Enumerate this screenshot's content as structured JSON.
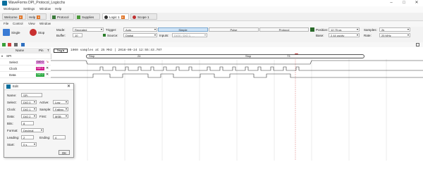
{
  "window": {
    "title": "WaveForms  DPI_Protocol_Logicchs",
    "minimize": "–",
    "maximize": "□",
    "close": "✕"
  },
  "menubar": {
    "items": [
      "Workspace",
      "Settings",
      "Window",
      "Help"
    ]
  },
  "tabs": [
    {
      "label": "Welcome"
    },
    {
      "label": "Help"
    },
    {
      "label": "Protocol"
    },
    {
      "label": "Supplies"
    },
    {
      "label": "Logic 1"
    },
    {
      "label": "Scope 1"
    }
  ],
  "submenu": {
    "items": [
      "File",
      "Control",
      "View",
      "Window"
    ]
  },
  "control": {
    "single_label": "Single",
    "stop_label": "Stop",
    "mode_label": "Mode:",
    "mode_value": "Repeated",
    "buffer_label": "Buffer:",
    "buffer_value": "10",
    "trigger_label": "Trigger:",
    "trigger_value": "Auto",
    "source_label": "Source:",
    "source_value": "Digital",
    "inputs_label": "Inputs:",
    "inputs_value": "DIO0 / DIO 1, ...",
    "trigger_tabs": [
      "Simple",
      "Pulse",
      "Protocol"
    ],
    "position_label": "Position:",
    "position_value": "12.75 us",
    "base_label": "Base:",
    "base_value": "2.44 us/div",
    "samples_label": "Samples:",
    "samples_value": "2k",
    "rate_label": "Rate:",
    "rate_value": "25 MHz"
  },
  "channels_header": {
    "name": "Name",
    "pin": "Pin",
    "t_label": "T"
  },
  "ruler": {
    "banner": "1000 samples at 25 MHz | 2018-09-24 12:55:43.707",
    "trigd": "Trig'd"
  },
  "channels": [
    {
      "name": "SPI",
      "pin": "",
      "color": "#ffffff"
    },
    {
      "name": "Select",
      "pin": "DIO 0",
      "color": "#e58ee0"
    },
    {
      "name": "Clock",
      "pin": "DIO 1",
      "color": "#d0178a"
    },
    {
      "name": "Data",
      "pin": "DIO 2",
      "color": "#23a63a"
    }
  ],
  "bus_labels": {
    "start": "Stop",
    "first": "24",
    "second": "Stop",
    "third": "73"
  },
  "dialog": {
    "title": "Edit",
    "name_label": "Name:",
    "name_value": "SPI",
    "select_label": "Select:",
    "select_value": "DIO 0",
    "active_label": "Active:",
    "active_value": "Low",
    "clock_label": "Clock:",
    "clock_value": "DIO 1",
    "sample_label": "Sample:",
    "sample_value": "Falling",
    "data_label": "Data:",
    "data_value": "DIO 2",
    "first_label": "First:",
    "first_value": "MSB",
    "bits_label": "Bits:",
    "bits_value": "8",
    "format_label": "Format:",
    "format_value": "Decimal",
    "leading_label": "Leading:",
    "leading_value": "2",
    "ending_label": "Ending:",
    "ending_value": "4",
    "start_label": "Start:",
    "start_value": "0 s",
    "ok_label": "OK"
  },
  "colors": {
    "accent": "#0a6f9e",
    "select": "#e58ee0",
    "clock": "#d0178a",
    "data": "#23a63a"
  }
}
